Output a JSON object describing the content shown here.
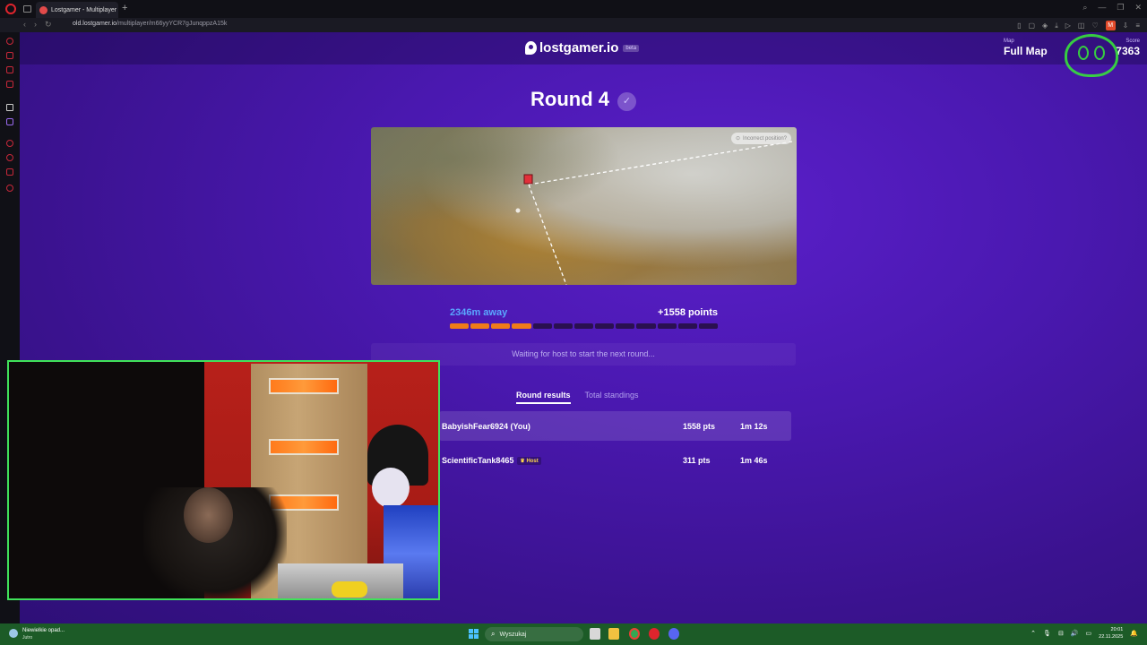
{
  "browser": {
    "tab_title": "Lostgamer - Multiplayer",
    "new_tab_glyph": "+",
    "url_domain": "old.lostgamer.io",
    "url_path": "/multiplayer/m66yyYCR7gJunqppzA15k",
    "nav_back": "‹",
    "nav_forward": "›",
    "nav_reload": "↻",
    "profile_initial": "M"
  },
  "header": {
    "logo_text": "lostgamer.io",
    "beta_label": "beta",
    "map_label": "Map",
    "map_name": "Full Map",
    "score_label": "Score",
    "score_value": "7363"
  },
  "round": {
    "title": "Round 4",
    "check_glyph": "✓",
    "incorrect_position_label": "Incorrect position?",
    "distance": "2346m away",
    "points": "+1558 points",
    "score_fraction": 0.31,
    "waiting_text": "Waiting for host to start the next round..."
  },
  "results": {
    "tabs": [
      "Round results",
      "Total standings"
    ],
    "active_tab": "Round results",
    "rows": [
      {
        "name": "BabyishFear6924 (You)",
        "badge": "",
        "points": "1558 pts",
        "time": "1m 12s"
      },
      {
        "name": "ScientificTank8465",
        "badge": "Host",
        "points": "311 pts",
        "time": "1m 46s"
      }
    ]
  },
  "taskbar": {
    "weather_title": "Niewielkie opad...",
    "weather_sub": "Jutro",
    "search_placeholder": "Wyszukaj",
    "time": "20:01",
    "date": "22.11.2025"
  },
  "colors": {
    "page_bg": "#4a18b0",
    "distance": "#5aa7ff",
    "score_segment": "#f07c18",
    "webcam_border": "#40e15a",
    "taskbar": "#1c5b27"
  }
}
